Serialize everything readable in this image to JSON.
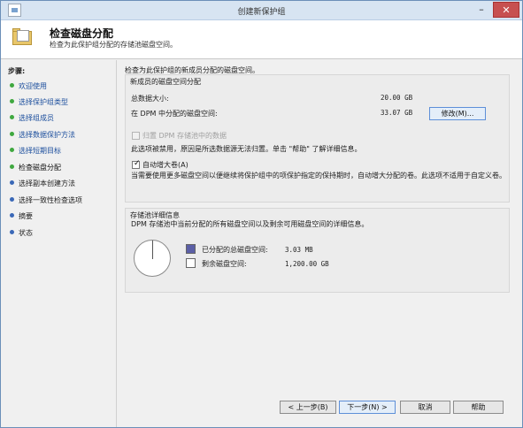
{
  "window": {
    "title": "创建新保护组",
    "minimize_glyph": "–",
    "close_glyph": "✕"
  },
  "header": {
    "title": "检查磁盘分配",
    "subtitle": "检查为此保护组分配的存储池磁盘空间。"
  },
  "steps": {
    "title": "步骤:",
    "items": [
      {
        "label": "欢迎使用",
        "state": "done"
      },
      {
        "label": "选择保护组类型",
        "state": "done"
      },
      {
        "label": "选择组成员",
        "state": "done"
      },
      {
        "label": "选择数据保护方法",
        "state": "done"
      },
      {
        "label": "选择短期目标",
        "state": "done"
      },
      {
        "label": "检查磁盘分配",
        "state": "current"
      },
      {
        "label": "选择副本创建方法",
        "state": "todo"
      },
      {
        "label": "选择一致性检查选项",
        "state": "todo"
      },
      {
        "label": "摘要",
        "state": "todo"
      },
      {
        "label": "状态",
        "state": "todo"
      }
    ]
  },
  "main": {
    "intro": "检查为此保护组的新成员分配的磁盘空间。",
    "allocation": {
      "title": "新成员的磁盘空间分配",
      "total_label": "总数据大小:",
      "total_value": "20.00 GB",
      "dpm_label": "在 DPM 中分配的磁盘空间:",
      "dpm_value": "33.07 GB",
      "modify_button": "修改(M)...",
      "colocate_label": "归置 DPM 存储池中的数据",
      "colocate_note": "此选项被禁用，原因是所选数据源无法归置。单击 \"帮助\" 了解详细信息。",
      "autogrow_label": "自动增大卷(A)",
      "autogrow_checked": true,
      "autogrow_desc": "当需要使用更多磁盘空间以便继续将保护组中的项保护指定的保持期时，自动增大分配的卷。此选项不适用于自定义卷。"
    },
    "pool": {
      "title": "存储池详细信息",
      "desc": "DPM 存储池中当前分配的所有磁盘空间以及剩余可用磁盘空间的详细信息。",
      "allocated_label": "已分配的总磁盘空间:",
      "allocated_value": "3.03 MB",
      "allocated_color": "#5b5fa6",
      "free_label": "剩余磁盘空间:",
      "free_value": "1,200.00 GB",
      "free_color": "#ffffff"
    }
  },
  "footer": {
    "back": "< 上一步(B)",
    "next": "下一步(N) >",
    "cancel": "取消",
    "help": "帮助"
  }
}
